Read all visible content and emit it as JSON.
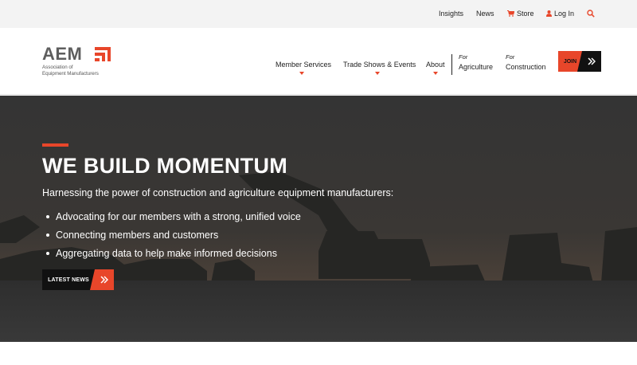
{
  "utility_nav": {
    "insights": "Insights",
    "news": "News",
    "store": "Store",
    "login": "Log In",
    "icons": {
      "store": "cart-icon",
      "login": "user-icon",
      "search": "search-icon"
    }
  },
  "logo": {
    "text": "AEM",
    "line1": "Association of",
    "line2": "Equipment Manufacturers"
  },
  "main_nav": {
    "member_services": "Member Services",
    "trade_shows": "Trade Shows & Events",
    "about": "About",
    "for_label": "For",
    "agriculture": "Agriculture",
    "construction": "Construction",
    "join": "JOIN"
  },
  "hero": {
    "title": "WE BUILD MOMENTUM",
    "subtitle": "Harnessing the power of construction and agriculture equipment manufacturers:",
    "bullets": [
      "Advocating for our members with a strong, unified voice",
      "Connecting members and customers",
      "Aggregating data to help make informed decisions"
    ],
    "cta": "LATEST NEWS"
  },
  "colors": {
    "accent": "#e8462a",
    "dark": "#111111",
    "utility_bg": "#f3f3f3",
    "hero_bg": "#333333"
  }
}
